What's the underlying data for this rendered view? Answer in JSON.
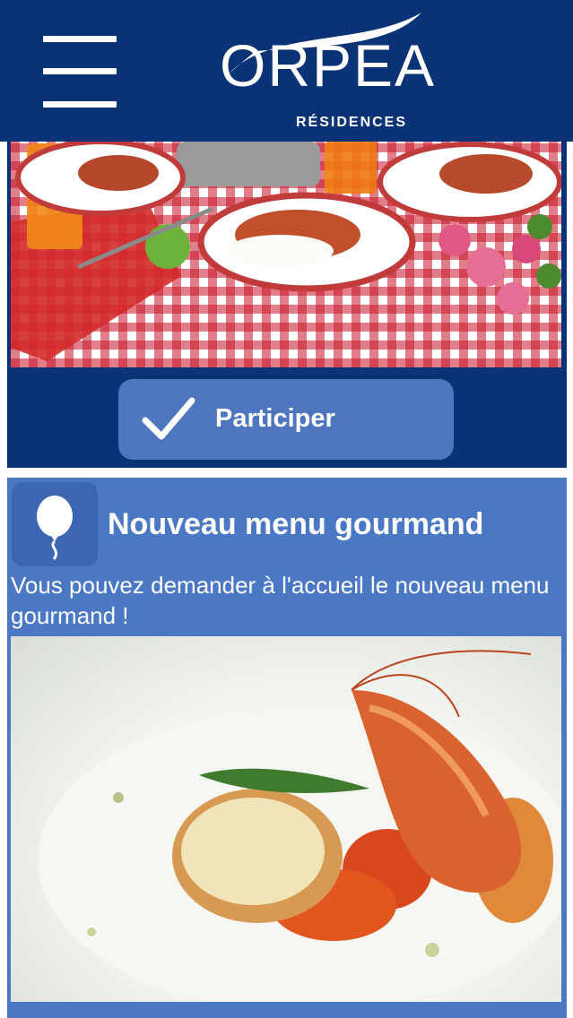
{
  "header": {
    "brand": "ORPEA",
    "subtitle": "RÉSIDENCES",
    "menu_icon": "hamburger-menu-icon",
    "background": "#0a3276"
  },
  "events": [
    {
      "image": "food-table-photo",
      "action_label": "Participer",
      "action_icon": "checkmark-icon"
    }
  ],
  "news": {
    "icon": "balloon-icon",
    "title": "Nouveau menu gourmand",
    "description": "Vous pouvez demander à l'accueil le nouveau menu gourmand !",
    "image": "seafood-dish-photo",
    "background": "#4a78c4"
  }
}
